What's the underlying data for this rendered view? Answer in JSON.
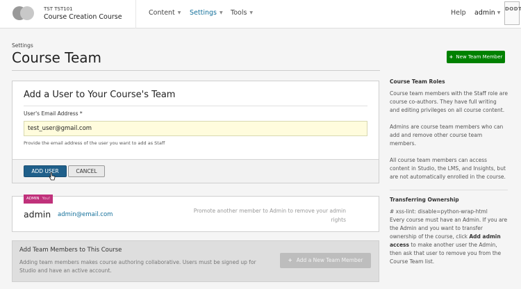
{
  "header": {
    "course_org": "TST TST101",
    "course_title": "Course Creation Course",
    "nav": [
      {
        "label": "Content"
      },
      {
        "label": "Settings"
      },
      {
        "label": "Tools"
      }
    ],
    "help_label": "Help",
    "user_label": "admin",
    "badge_text": "DODT",
    "caret_glyph": "▼"
  },
  "page": {
    "breadcrumb": "Settings",
    "title": "Course Team",
    "new_member_button": "New Team Member",
    "new_member_icon": "+"
  },
  "form": {
    "title": "Add a User to Your Course's Team",
    "email_label": "User's Email Address *",
    "email_value": "test_user@gmail.com",
    "email_help": "Provide the email address of the user you want to add as Staff",
    "add_button": "ADD USER",
    "cancel_button": "CANCEL"
  },
  "member": {
    "role_badge": "ADMIN",
    "you_tag": "You!",
    "name": "admin",
    "email": "admin@email.com",
    "promote_note": "Promote another member to Admin to remove your admin rights"
  },
  "add_panel": {
    "title": "Add Team Members to This Course",
    "text": "Adding team members makes course authoring collaborative. Users must be signed up for Studio and have an active account.",
    "button": "Add a New Team Member",
    "button_icon": "+"
  },
  "sidebar": {
    "roles_heading": "Course Team Roles",
    "roles_p1": "Course team members with the Staff role are course co-authors. They have full writing and editing privileges on all course content.",
    "roles_p2": "Admins are course team members who can add and remove other course team members.",
    "roles_p3": "All course team members can access content in Studio, the LMS, and Insights, but are not automatically enrolled in the course.",
    "transfer_heading": "Transferring Ownership",
    "transfer_lint": "# xss-lint: disable=python-wrap-html",
    "transfer_text_1": "Every course must have an Admin. If you are the Admin and you want to transfer ownership of the course, click ",
    "transfer_bold": "Add admin access",
    "transfer_text_2": " to make another user the Admin, then ask that user to remove you from the Course Team list."
  },
  "colors": {
    "brand_green": "#008100",
    "primary_blue": "#1f5f8a",
    "link_blue": "#126f9a",
    "admin_badge": "#c0317b",
    "input_highlight": "#fffcdd"
  }
}
